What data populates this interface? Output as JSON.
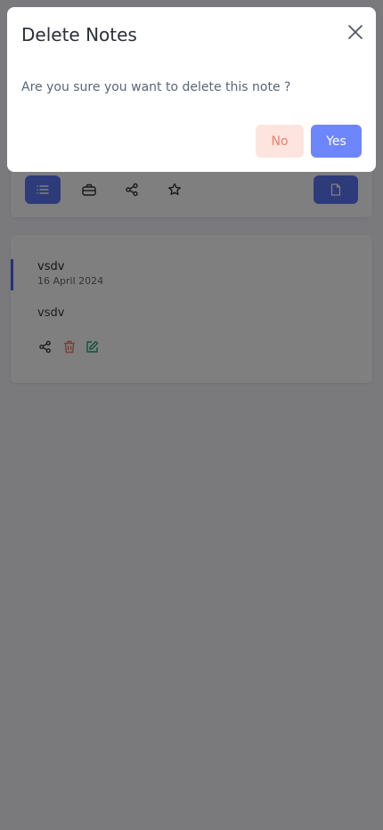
{
  "modal": {
    "title": "Delete Notes",
    "message": "Are you sure you want to delete this note ?",
    "no_label": "No",
    "yes_label": "Yes"
  },
  "toolbar": {
    "buttons": [
      {
        "icon": "list-icon"
      },
      {
        "icon": "briefcase-icon"
      },
      {
        "icon": "share-icon"
      },
      {
        "icon": "star-icon"
      },
      {
        "icon": "file-icon"
      }
    ]
  },
  "note": {
    "title": "vsdv",
    "date": "16 April 2024",
    "body": "vsdv",
    "actions": [
      {
        "icon": "share-icon"
      },
      {
        "icon": "trash-icon"
      },
      {
        "icon": "edit-icon"
      }
    ]
  },
  "colors": {
    "primary": "#5d76f5",
    "danger": "#f07f6c",
    "success": "#18a878",
    "overlay": "rgba(0,0,0,0.5)"
  }
}
